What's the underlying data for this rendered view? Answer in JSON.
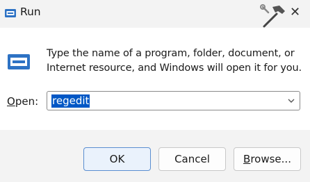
{
  "window": {
    "title": "Run",
    "title_icon": "run-icon",
    "watermark_icon": "hammer-wrench-icon",
    "close_icon": "close-icon",
    "close_glyph": "✕"
  },
  "content": {
    "large_icon": "run-icon",
    "description": "Type the name of a program, folder, document, or Internet resource, and Windows will open it for you.",
    "open_label_underlined": "O",
    "open_label_rest": "pen:",
    "open_value": "regedit",
    "dropdown_icon": "chevron-down-icon"
  },
  "buttons": {
    "ok": "OK",
    "cancel": "Cancel",
    "browse_underlined": "B",
    "browse_rest": "rowse..."
  },
  "colors": {
    "selection": "#0057c5",
    "accent": "#2d72c4",
    "window_bg": "#f3f3f3",
    "content_bg": "#ffffff"
  }
}
